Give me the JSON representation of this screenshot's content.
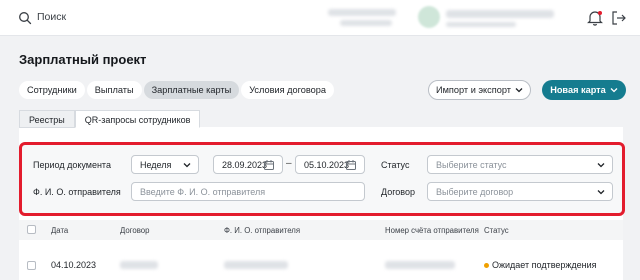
{
  "topbar": {
    "search_label": "Поиск"
  },
  "page": {
    "title": "Зарплатный проект"
  },
  "tabs": [
    {
      "label": "Сотрудники",
      "active": false
    },
    {
      "label": "Выплаты",
      "active": false
    },
    {
      "label": "Зарплатные карты",
      "active": true
    },
    {
      "label": "Условия договора",
      "active": false
    }
  ],
  "actions": {
    "import_export": "Импорт и экспорт",
    "new_card": "Новая карта"
  },
  "subtabs": [
    {
      "label": "Реестры",
      "active": false
    },
    {
      "label": "QR-запросы сотрудников",
      "active": true
    }
  ],
  "filters": {
    "period_label": "Период документа",
    "period_value": "Неделя",
    "date_from": "28.09.2023",
    "date_to": "05.10.2023",
    "status_label": "Статус",
    "status_placeholder": "Выберите статус",
    "sender_label": "Ф. И. О. отправителя",
    "sender_placeholder": "Введите Ф. И. О. отправителя",
    "contract_label": "Договор",
    "contract_placeholder": "Выберите договор"
  },
  "table": {
    "columns": [
      "Дата",
      "Договор",
      "Ф. И. О. отправителя",
      "Номер счёта отправителя",
      "Статус"
    ],
    "rows": [
      {
        "date": "04.10.2023",
        "status": "Ожидает подтверждения"
      }
    ]
  },
  "colors": {
    "accent": "#157c8f",
    "highlight": "#e31c2d",
    "status_pending": "#f0a000"
  }
}
